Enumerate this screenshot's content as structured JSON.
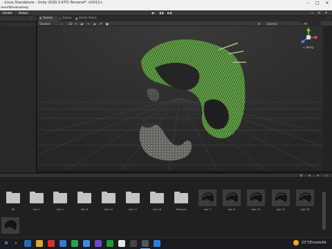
{
  "window": {
    "title": "- Linux Standalone - Unity 2020.3.47f1 Personal* <DX11>",
    "menu": [
      "ment",
      "Window",
      "Help"
    ]
  },
  "toolbar": {
    "center_label": "Center",
    "global_label": "Global",
    "play_icon": "play-icon",
    "pause_icon": "pause-icon",
    "step_icon": "step-icon"
  },
  "scene": {
    "tabs": [
      "Scene",
      "Game",
      "Asset Store"
    ],
    "shading_mode": "Shaded",
    "gizmos_label": "Gizmos",
    "all_label": "All",
    "twod_label": "2D",
    "persp_label": "< Persp"
  },
  "project": {
    "assets": [
      {
        "type": "folder",
        "label": "06"
      },
      {
        "type": "folder",
        "label": "hair 1"
      },
      {
        "type": "folder",
        "label": "hair 2"
      },
      {
        "type": "folder",
        "label": "hair 6"
      },
      {
        "type": "folder",
        "label": "hair 10"
      },
      {
        "type": "folder",
        "label": "hair 11"
      },
      {
        "type": "folder",
        "label": "hair 16"
      },
      {
        "type": "folder",
        "label": "Textures"
      },
      {
        "type": "model",
        "label": "hair 1"
      },
      {
        "type": "model",
        "label": "hair 6"
      },
      {
        "type": "model",
        "label": "hair 10"
      },
      {
        "type": "model",
        "label": "hair 11"
      },
      {
        "type": "model",
        "label": "hair 16"
      }
    ]
  },
  "taskbar": {
    "temperature": "23°C",
    "weather": "Ensoleillé"
  },
  "colors": {
    "hair_green": "#3d7a2a",
    "hair_light": "#9fbf6a",
    "beard_grey": "#8a8a88",
    "grid": "#4a4a4a"
  }
}
